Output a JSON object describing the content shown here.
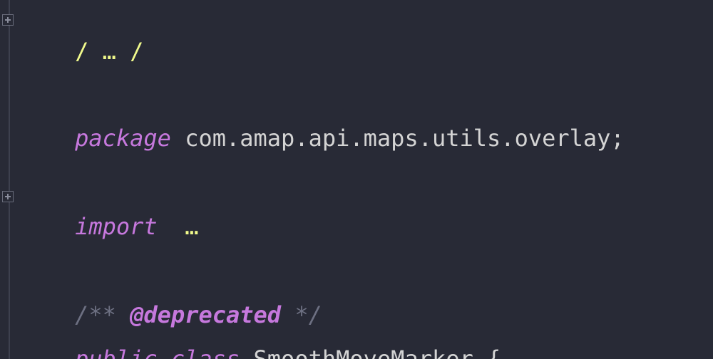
{
  "editor": {
    "lines": {
      "header_fold": "/ … /",
      "package_keyword": "package",
      "package_name": "com.amap.api.maps.utils.overlay;",
      "import_keyword": "import",
      "import_fold": "…",
      "comment_open": "/**",
      "comment_tag": "@deprecated",
      "comment_close": "*/",
      "class_public": "public",
      "class_keyword": "class",
      "class_name": "SmoothMoveMarker",
      "class_brace": "{"
    },
    "colors": {
      "background": "#282a36",
      "keyword": "#c678dd",
      "folded_text": "#f1fa8c",
      "comment": "#6d7082",
      "plain": "#d4d4d4"
    }
  }
}
